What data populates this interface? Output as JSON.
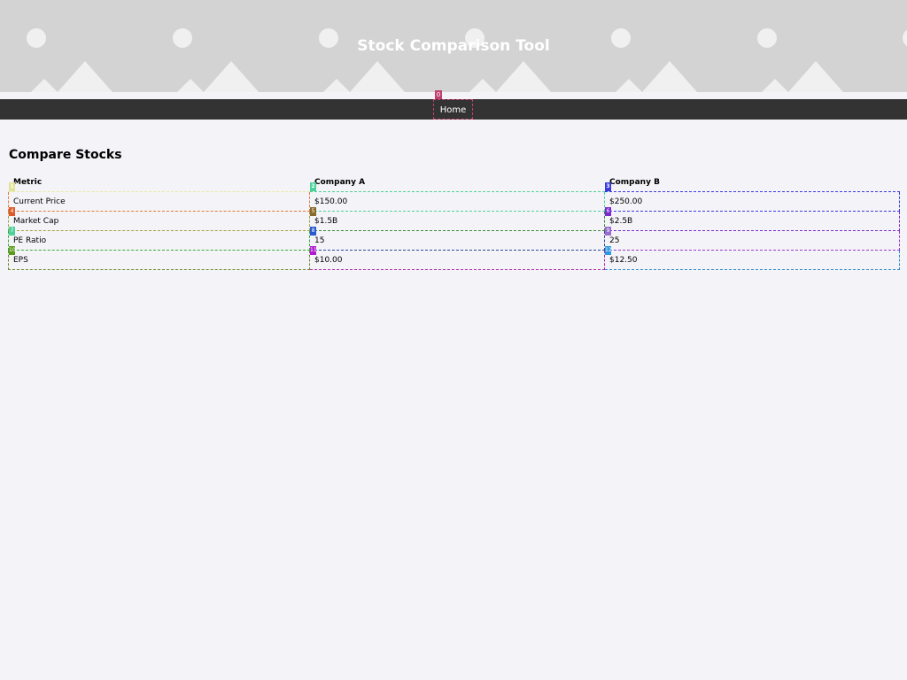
{
  "header": {
    "title": "Stock Comparison Tool"
  },
  "nav": {
    "home_label": "Home",
    "home_marker": "0"
  },
  "main": {
    "heading": "Compare Stocks",
    "table": {
      "headers": [
        "Metric",
        "Company A",
        "Company B"
      ],
      "rows": [
        [
          "Current Price",
          "$150.00",
          "$250.00"
        ],
        [
          "Market Cap",
          "$1.5B",
          "$2.5B"
        ],
        [
          "PE Ratio",
          "15",
          "25"
        ],
        [
          "EPS",
          "$10.00",
          "$12.50"
        ]
      ]
    }
  },
  "markers": {
    "header_row": [
      "1",
      "2",
      "3"
    ],
    "rows": [
      [
        "4",
        "5",
        "6"
      ],
      [
        "7",
        "8",
        "9"
      ],
      [
        "10",
        "11",
        "12"
      ]
    ]
  },
  "colors": {
    "banner": "#d3d3d3",
    "navbar": "#333333",
    "page_bg": "#f4f4f8"
  }
}
